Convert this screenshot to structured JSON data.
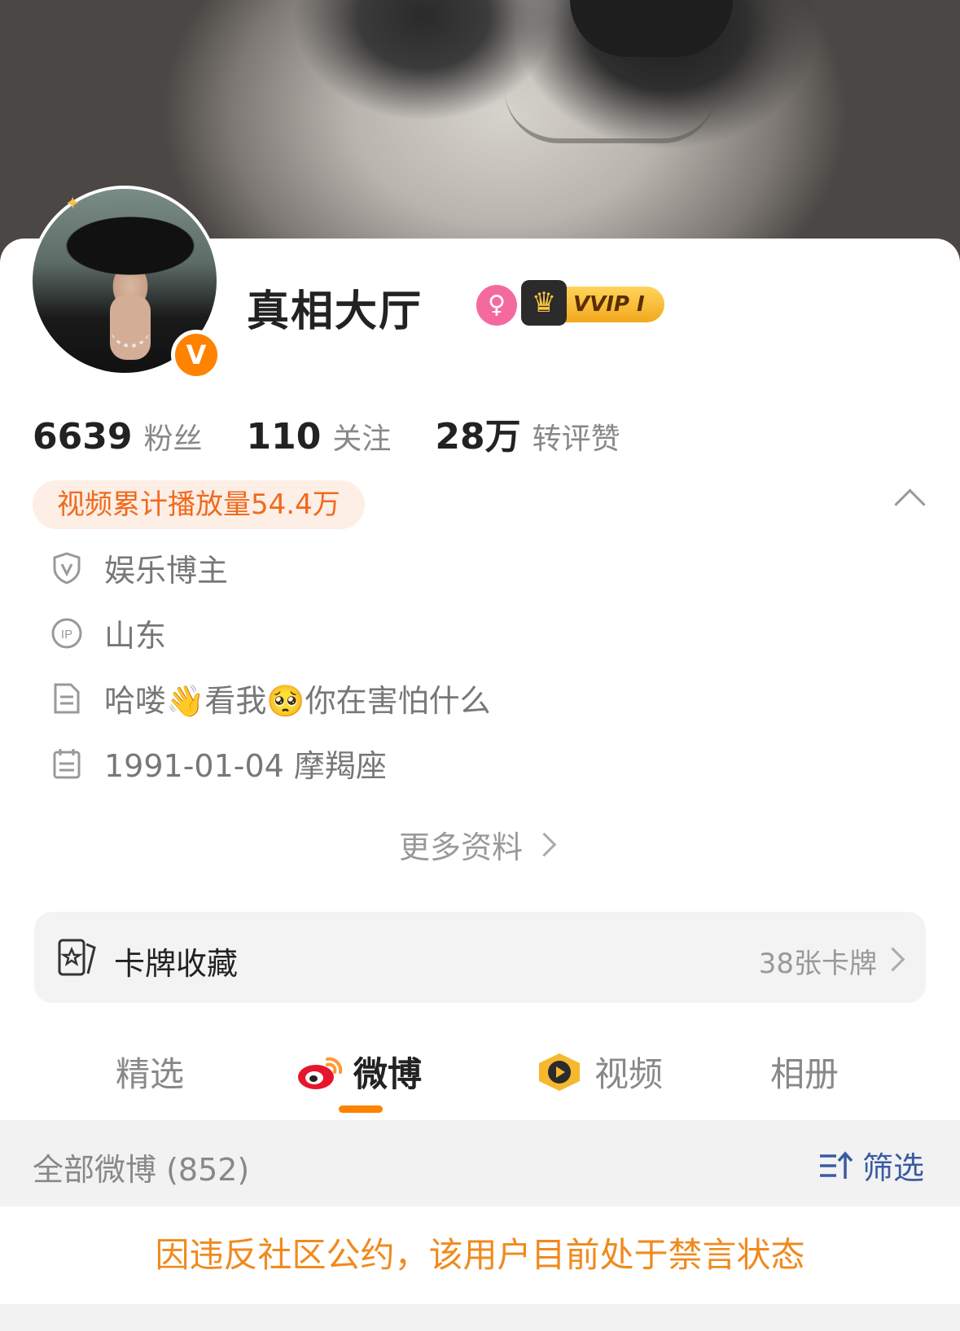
{
  "profile": {
    "name": "真相大厅",
    "vip_label": "VVIP I",
    "verified_mark": "V"
  },
  "stats": [
    {
      "num": "6639",
      "label": "粉丝"
    },
    {
      "num": "110",
      "label": "关注"
    },
    {
      "num": "28万",
      "label": "转评赞"
    }
  ],
  "play_count": "视频累计播放量54.4万",
  "info": {
    "category": "娱乐博主",
    "ip_location": "山东",
    "bio": "哈喽👋看我🥺你在害怕什么",
    "birthday": "1991-01-04 摩羯座",
    "ip_label": "IP"
  },
  "more_info_label": "更多资料",
  "cards": {
    "title": "卡牌收藏",
    "count": "38张卡牌"
  },
  "tabs": [
    {
      "label": "精选"
    },
    {
      "label": "微博"
    },
    {
      "label": "视频"
    },
    {
      "label": "相册"
    }
  ],
  "feed": {
    "count_label": "全部微博 (852)",
    "filter_label": "筛选"
  },
  "notice": "因违反社区公约，该用户目前处于禁言状态",
  "colors": {
    "accent": "#ff8200",
    "notice": "#f08a1d",
    "filter": "#3a5ba3",
    "pill_bg": "#fdeee6"
  }
}
